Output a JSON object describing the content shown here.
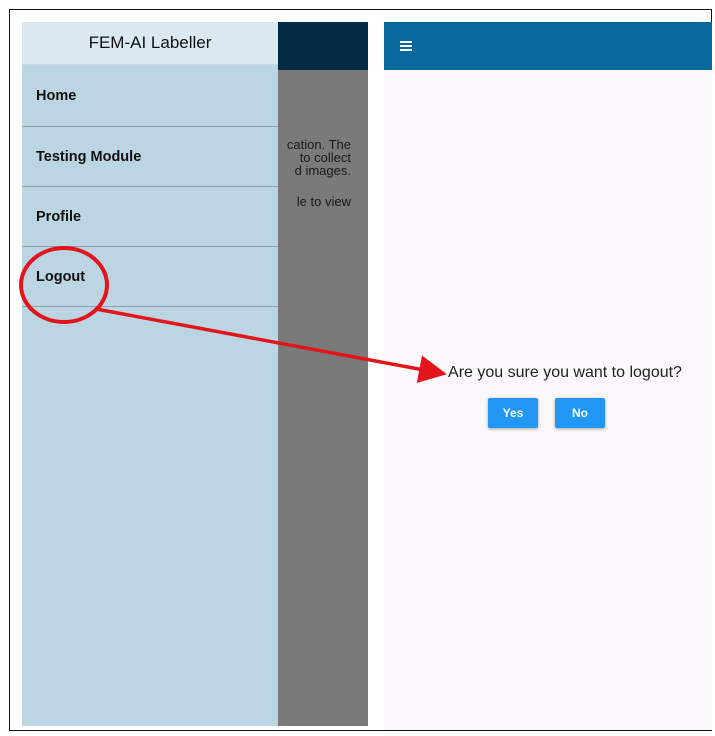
{
  "drawer": {
    "title": "FEM-AI Labeller",
    "items": [
      {
        "label": "Home"
      },
      {
        "label": "Testing Module"
      },
      {
        "label": "Profile"
      },
      {
        "label": "Logout"
      }
    ]
  },
  "background_text": {
    "lines": [
      "cation. The",
      "to collect",
      "d images.",
      "",
      "le to view"
    ]
  },
  "dialog": {
    "message": "Are you sure you want to logout?",
    "yes_label": "Yes",
    "no_label": "No"
  },
  "colors": {
    "drawer_bg": "#bcd5e2",
    "appbar": "#06689b",
    "button": "#2196f3",
    "annotation": "#e3141b"
  },
  "icons": {
    "menu": "menu-icon"
  }
}
